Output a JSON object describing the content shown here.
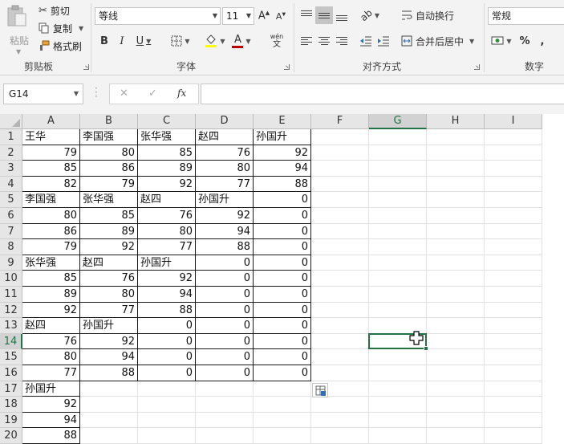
{
  "ribbon": {
    "clipboard": {
      "paste_label": "粘贴",
      "cut_label": "剪切",
      "copy_label": "复制",
      "format_painter_label": "格式刷",
      "group_label": "剪贴板"
    },
    "font": {
      "font_name": "等线",
      "font_size": "11",
      "bold": "B",
      "italic": "I",
      "underline": "U",
      "font_color_glyph": "A",
      "phonetic_top": "wén",
      "phonetic_bottom": "文",
      "group_label": "字体"
    },
    "alignment": {
      "wrap_text_label": "自动换行",
      "merge_center_label": "合并后居中",
      "group_label": "对齐方式"
    },
    "number": {
      "format_value": "常规",
      "percent": "%",
      "comma": ",",
      "group_label": "数字"
    },
    "colors": {
      "accent": "#217346",
      "font_color_bar": "#c00000",
      "fill_color_bar": "#ffff00"
    }
  },
  "formula_bar": {
    "name_box": "G14",
    "cancel_glyph": "✕",
    "enter_glyph": "✓",
    "fx_glyph": "fx",
    "formula": ""
  },
  "sheet": {
    "columns": [
      "A",
      "B",
      "C",
      "D",
      "E",
      "F",
      "G",
      "H",
      "I"
    ],
    "active_column": "G",
    "active_row": 14,
    "selected_cell": "G14",
    "rows": [
      {
        "n": "1",
        "cells": [
          "王华",
          "李国强",
          "张华强",
          "赵四",
          "孙国升",
          "",
          "",
          "",
          ""
        ]
      },
      {
        "n": "2",
        "cells": [
          "79",
          "80",
          "85",
          "76",
          "92",
          "",
          "",
          "",
          ""
        ]
      },
      {
        "n": "3",
        "cells": [
          "85",
          "86",
          "89",
          "80",
          "94",
          "",
          "",
          "",
          ""
        ]
      },
      {
        "n": "4",
        "cells": [
          "82",
          "79",
          "92",
          "77",
          "88",
          "",
          "",
          "",
          ""
        ]
      },
      {
        "n": "5",
        "cells": [
          "李国强",
          "张华强",
          "赵四",
          "孙国升",
          "0",
          "",
          "",
          "",
          ""
        ]
      },
      {
        "n": "6",
        "cells": [
          "80",
          "85",
          "76",
          "92",
          "0",
          "",
          "",
          "",
          ""
        ]
      },
      {
        "n": "7",
        "cells": [
          "86",
          "89",
          "80",
          "94",
          "0",
          "",
          "",
          "",
          ""
        ]
      },
      {
        "n": "8",
        "cells": [
          "79",
          "92",
          "77",
          "88",
          "0",
          "",
          "",
          "",
          ""
        ]
      },
      {
        "n": "9",
        "cells": [
          "张华强",
          "赵四",
          "孙国升",
          "0",
          "0",
          "",
          "",
          "",
          ""
        ]
      },
      {
        "n": "10",
        "cells": [
          "85",
          "76",
          "92",
          "0",
          "0",
          "",
          "",
          "",
          ""
        ]
      },
      {
        "n": "11",
        "cells": [
          "89",
          "80",
          "94",
          "0",
          "0",
          "",
          "",
          "",
          ""
        ]
      },
      {
        "n": "12",
        "cells": [
          "92",
          "77",
          "88",
          "0",
          "0",
          "",
          "",
          "",
          ""
        ]
      },
      {
        "n": "13",
        "cells": [
          "赵四",
          "孙国升",
          "0",
          "0",
          "0",
          "",
          "",
          "",
          ""
        ]
      },
      {
        "n": "14",
        "cells": [
          "76",
          "92",
          "0",
          "0",
          "0",
          "",
          "",
          "",
          ""
        ]
      },
      {
        "n": "15",
        "cells": [
          "80",
          "94",
          "0",
          "0",
          "0",
          "",
          "",
          "",
          ""
        ]
      },
      {
        "n": "16",
        "cells": [
          "77",
          "88",
          "0",
          "0",
          "0",
          "",
          "",
          "",
          ""
        ]
      },
      {
        "n": "17",
        "cells": [
          "孙国升",
          "",
          "",
          "",
          "",
          "",
          "",
          "",
          ""
        ]
      },
      {
        "n": "18",
        "cells": [
          "92",
          "",
          "",
          "",
          "",
          "",
          "",
          "",
          ""
        ]
      },
      {
        "n": "19",
        "cells": [
          "94",
          "",
          "",
          "",
          "",
          "",
          "",
          "",
          ""
        ]
      },
      {
        "n": "20",
        "cells": [
          "88",
          "",
          "",
          "",
          "",
          "",
          "",
          "",
          ""
        ]
      }
    ]
  }
}
